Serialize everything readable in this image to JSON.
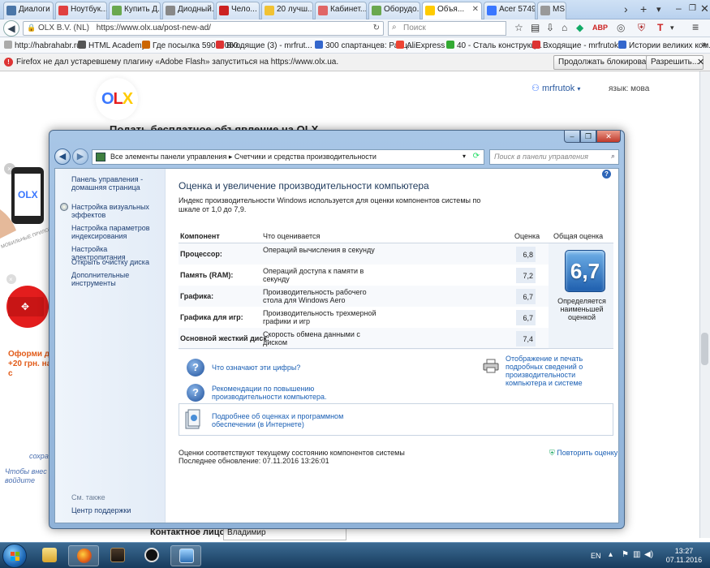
{
  "browser": {
    "tabs": [
      {
        "label": "Диалоги",
        "color": "#4a76a8"
      },
      {
        "label": "Ноутбук...",
        "color": "#e04040"
      },
      {
        "label": "Купить Д...",
        "color": "#6aa84f"
      },
      {
        "label": "Диодный...",
        "color": "#888888"
      },
      {
        "label": "Чело...",
        "color": "#cc2222"
      },
      {
        "label": "20 лучш...",
        "color": "#f1c232"
      },
      {
        "label": "Кабинет...",
        "color": "#e06666"
      },
      {
        "label": "Оборудо...",
        "color": "#6aa84f"
      },
      {
        "label": "Объя...",
        "color": "#ffcb00",
        "active": true
      },
      {
        "label": "Acer 5749...",
        "color": "#3a77ff"
      },
      {
        "label": "MS",
        "color": "#999999"
      }
    ],
    "address": {
      "site": "OLX B.V. (NL)",
      "url": "https://www.olx.ua/post-new-ad/"
    },
    "search_placeholder": "Поиск",
    "bookmarks": [
      "http://habrahabr.ru/",
      "HTML Academy",
      "Где посылка 59039060...",
      "Входящие (3) - mrfrut...",
      "300 спартанцев: Расц...",
      "AliExpress",
      "40 - Сталь конструкц...",
      "Входящие - mrfrutok...",
      "Истории великих ком..."
    ],
    "notice": {
      "text": "Firefox не дал устаревшему плагину «Adobe Flash» запуститься на https://www.olx.ua.",
      "continue_label": "Продолжать блокировать",
      "allow_label": "Разрешить..."
    }
  },
  "olx": {
    "logo": {
      "o": "O",
      "l": "L",
      "x": "X"
    },
    "user": "mrfrutok",
    "lang": "язык: мова",
    "heading": "Подать бесплатное объявление на OLX",
    "promo_app": "МОБИЛЬНЫЕ ПРИЛОЖЕНИЯ",
    "promo_offer": "Оформи до +20 грн. на с",
    "hand1": "сохра",
    "hand2": "Чтобы внес войдите",
    "contact_label": "Контактное лицо*",
    "contact_value": "Владимир"
  },
  "dialog": {
    "address_path": "Все элементы панели управления  ▸  Счетчики и средства производительности",
    "search_placeholder": "Поиск в панели управления",
    "sidebar": {
      "home": "Панель управления - домашняя страница",
      "links": [
        "Настройка визуальных эффектов",
        "Настройка параметров индексирования",
        "Настройка электропитания",
        "Открыть очистку диска",
        "Дополнительные инструменты"
      ],
      "see_also": "См. также",
      "support": "Центр поддержки"
    },
    "title": "Оценка и увеличение производительности компьютера",
    "description": "Индекс производительности Windows используется для оценки компонентов системы по шкале от 1,0 до 7,9.",
    "table": {
      "headers": {
        "component": "Компонент",
        "what": "Что оценивается",
        "score": "Оценка",
        "overall": "Общая оценка"
      },
      "rows": [
        {
          "component": "Процессор:",
          "what": "Операций вычисления в секунду",
          "score": "6,8"
        },
        {
          "component": "Память (RAM):",
          "what": "Операций доступа к памяти в секунду",
          "score": "7,2"
        },
        {
          "component": "Графика:",
          "what": "Производительность рабочего стола для Windows Aero",
          "score": "6,7"
        },
        {
          "component": "Графика для игр:",
          "what": "Производительность трехмерной графики и игр",
          "score": "6,7"
        },
        {
          "component": "Основной жесткий диск:",
          "what": "Скорость обмена данными с диском",
          "score": "7,4"
        }
      ],
      "overall_score": "6,7",
      "overall_note": "Определяется наименьшей оценкой"
    },
    "links": {
      "meaning": "Что означают эти цифры?",
      "tips": "Рекомендации по повышению производительности компьютера.",
      "print": "Отображение и печать подробных сведений о производительности компьютера и системе",
      "more": "Подробнее об оценках и программном обеспечении (в Интернете)"
    },
    "status_line1": "Оценки соответствуют текущему состоянию компонентов системы",
    "status_line2": "Последнее обновление: 07.11.2016 13:26:01",
    "rerun": "Повторить оценку"
  },
  "taskbar": {
    "lang": "EN",
    "time": "13:27",
    "date": "07.11.2016"
  }
}
